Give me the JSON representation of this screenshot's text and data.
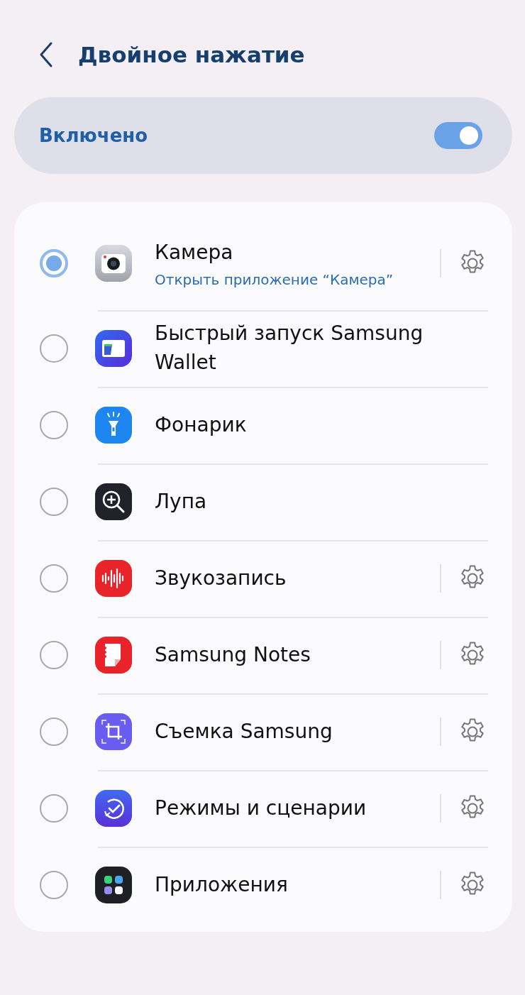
{
  "header": {
    "title": "Двойное нажатие"
  },
  "master_switch": {
    "label": "Включено",
    "on": true
  },
  "options": [
    {
      "title": "Камера",
      "subtitle": "Открыть приложение “Камера”",
      "selected": true,
      "settings": true
    },
    {
      "title": "Быстрый запуск Samsung Wallet",
      "selected": false,
      "settings": false
    },
    {
      "title": "Фонарик",
      "selected": false,
      "settings": false
    },
    {
      "title": "Лупа",
      "selected": false,
      "settings": false
    },
    {
      "title": "Звукозапись",
      "selected": false,
      "settings": true
    },
    {
      "title": "Samsung Notes",
      "selected": false,
      "settings": true
    },
    {
      "title": "Съемка Samsung",
      "selected": false,
      "settings": true
    },
    {
      "title": "Режимы и сценарии",
      "selected": false,
      "settings": true
    },
    {
      "title": "Приложения",
      "selected": false,
      "settings": true
    }
  ]
}
